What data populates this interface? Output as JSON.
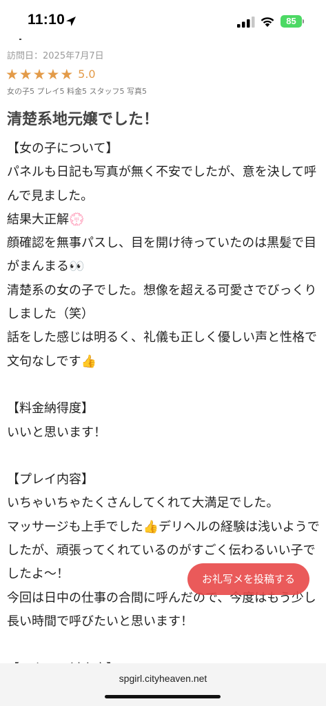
{
  "status_bar": {
    "time": "11:10",
    "battery": "85"
  },
  "review": {
    "visit_date": "訪問日：2025年7月7日",
    "stars": [
      "★",
      "★",
      "★",
      "★",
      "★"
    ],
    "score": "5.0",
    "sub_ratings": "女の子5 プレイ5 料金5 スタッフ5 写真5",
    "title": "清楚系地元嬢でした！",
    "body": "【女の子について】\nパネルも日記も写真が無く不安でしたが、意を決して呼んで見ました。\n結果大正解💮\n顔確認を無事パスし、目を開け待っていたのは黒髪で目がまんまる👀\n清楚系の女の子でした。想像を超える可愛さでびっくりしました（笑）\n話をした感じは明るく、礼儀も正しく優しい声と性格で文句なしです👍\n\n【料金納得度】\nいいと思います！\n\n【プレイ内容】\nいちゃいちゃたくさんしてくれて大満足でした。\nマッサージも上手でした👍デリヘルの経験は浅いようでしたが、頑張ってくれているのがすごく伝わるいい子でしたよ〜！\n今回は日中の仕事の合間に呼んだので、今度はもう少し長い時間で呼びたいと思います！\n\n【スタッフ対応度】"
  },
  "floating_button": {
    "label": "お礼写メを投稿する"
  },
  "browser": {
    "url": "spgirl.cityheaven.net"
  },
  "colors": {
    "star": "#e39b49",
    "button": "#e84848",
    "battery": "#4cd964"
  }
}
